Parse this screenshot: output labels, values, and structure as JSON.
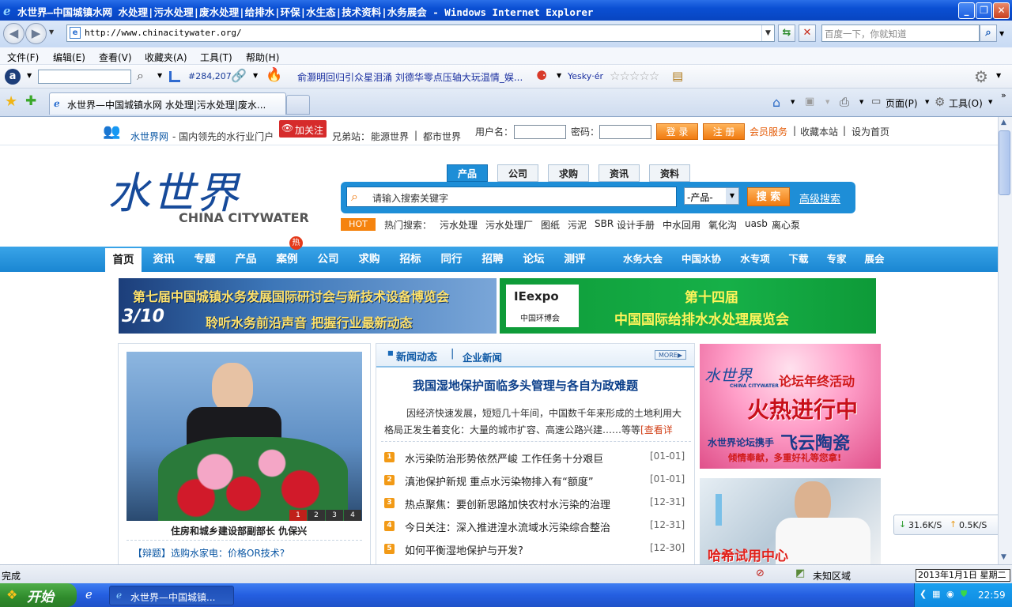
{
  "window": {
    "title": "水世界—中国城镇水网 水处理|污水处理|废水处理|给排水|环保|水生态|技术资料|水务展会 - Windows Internet Explorer",
    "minimize": "_",
    "maximize": "❐",
    "close": "✕"
  },
  "address": {
    "url": "http://www.chinacitywater.org/",
    "search_placeholder": "百度一下，你就知道"
  },
  "menu": [
    "文件(F)",
    "编辑(E)",
    "查看(V)",
    "收藏夹(A)",
    "工具(T)",
    "帮助(H)"
  ],
  "toolbar": {
    "rank": "#284,207",
    "news_ticker": "俞灏明回归引众星泪涌 刘德华零点压轴大玩温情_娱...",
    "yesky": "Yesky·ér"
  },
  "tabs": {
    "active": "水世界—中国城镇水网 水处理|污水处理|废水...",
    "home": "",
    "page_menu": "页面(P)",
    "tools_menu": "工具(O)"
  },
  "site": {
    "topbar": {
      "site_name": "水世界网",
      "slogan": " - 国内领先的水行业门户",
      "follow": "加关注",
      "sister_label": "兄弟站：",
      "sister1": "能源世界",
      "sister_sep": "|",
      "sister2": "都市世界",
      "user_label": "用户名：",
      "pwd_label": "密码：",
      "login": "登 录",
      "register": "注 册",
      "member": "会员服务",
      "sep1": "|",
      "bookmark": "收藏本站",
      "sep2": "|",
      "homepage": "设为首页"
    },
    "logo": {
      "cn": "水世界",
      "en": "CHINA CITYWATER"
    },
    "search_tabs": [
      "产品",
      "公司",
      "求购",
      "资讯",
      "资料"
    ],
    "search_placeholder": "请输入搜索关键字",
    "search_select": "-产品-",
    "search_btn": "搜 索",
    "adv_search": "高级搜索",
    "hot_badge": "HOT",
    "hot_label": "热门搜索：",
    "hot_terms": [
      "污水处理",
      "污水处理厂",
      "图纸",
      "污泥",
      "SBR",
      "设计手册",
      "中水回用",
      "氧化沟",
      "uasb",
      "离心泵"
    ],
    "nav_main": [
      "首页",
      "资讯",
      "专题",
      "产品",
      "案例",
      "公司",
      "求购",
      "招标",
      "同行",
      "招聘",
      "论坛",
      "测评"
    ],
    "nav_hot_badge": "热",
    "nav_sub": [
      "水务大会",
      "中国水协",
      "水专项",
      "下载",
      "专家",
      "展会"
    ],
    "banner1": {
      "line1": "第七届中国城镇水务发展国际研讨会与新技术设备博览会",
      "line2": "聆听水务前沿声音   把握行业最新动态",
      "logo": "3/10"
    },
    "banner2": {
      "logo": "IEexpo",
      "logo_sub": "中国环博会",
      "line1": "第十四届",
      "line2": "中国国际给排水水处理展览会"
    },
    "photo": {
      "caption": "住房和城乡建设部副部长 仇保兴",
      "pages": [
        "1",
        "2",
        "3",
        "4"
      ],
      "topic_tag": "【辩题】",
      "topic": "选购水家电：价格OR技术?"
    },
    "news": {
      "tab1": "新闻动态",
      "tab_sep": "|",
      "tab2": "企业新闻",
      "more": "MORE▶",
      "headline": "我国湿地保护面临多头管理与各自为政难题",
      "summary": "因经济快速发展，短短几十年间，中国数千年来形成的土地利用大格局正发生着变化：大量的城市扩容、高速公路兴建……等等",
      "more_link": "[查看详",
      "items": [
        {
          "num": "1",
          "title": "水污染防治形势依然严峻 工作任务十分艰巨",
          "date": "[01-01]"
        },
        {
          "num": "2",
          "title": "滇池保护新规 重点水污染物排入有“额度”",
          "date": "[01-01]"
        },
        {
          "num": "3",
          "title": "热点聚焦：要创新思路加快农村水污染的治理",
          "date": "[12-31]"
        },
        {
          "num": "4",
          "title": "今日关注：深入推进湟水流域水污染综合整治",
          "date": "[12-31]"
        },
        {
          "num": "5",
          "title": "如何平衡湿地保护与开发?",
          "date": "[12-30]"
        }
      ]
    },
    "ad1": {
      "logo": "水世界",
      "logo_en": "CHINA CITYWATER",
      "title": "论坛年终活动",
      "big": "火热进行中",
      "line1": "水世界论坛携手",
      "brand": "飞云陶瓷",
      "line2": "倾情奉献，多重好礼等您拿!"
    },
    "ad2": {
      "title": "哈希试用中心"
    },
    "speed": {
      "down": "31.6K/S",
      "up": "0.5K/S"
    }
  },
  "status": {
    "text": "完成",
    "zone": "未知区域",
    "date": "2013年1月1日 星期二"
  },
  "taskbar": {
    "start": "开始",
    "task": "水世界—中国城镇...",
    "clock": "22:59"
  },
  "colors": {
    "nav_blue": "#1e8ed7",
    "orange": "#f5830e",
    "green": "#11a23e"
  }
}
